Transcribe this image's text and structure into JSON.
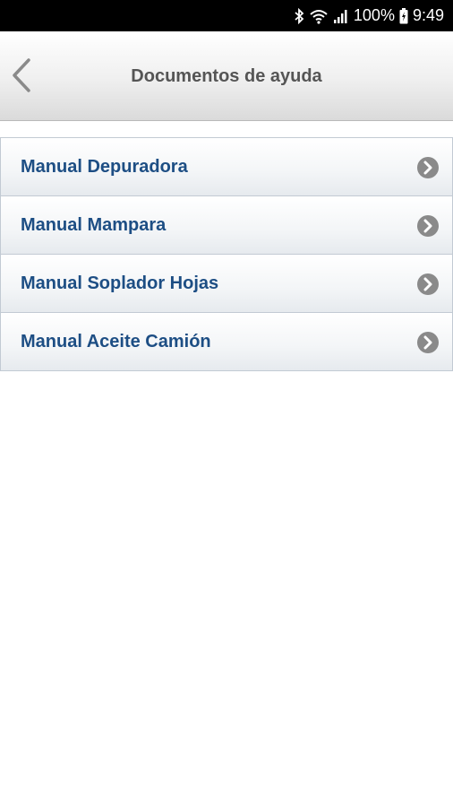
{
  "status_bar": {
    "battery": "100%",
    "time": "9:49",
    "icons": [
      "bluetooth-icon",
      "wifi-icon",
      "signal-icon",
      "battery-icon"
    ]
  },
  "header": {
    "title": "Documentos de ayuda",
    "back_icon": "chevron-left-icon"
  },
  "documents": [
    {
      "label": "Manual Depuradora"
    },
    {
      "label": "Manual Mampara"
    },
    {
      "label": "Manual Soplador Hojas"
    },
    {
      "label": "Manual Aceite Camión"
    }
  ],
  "colors": {
    "item_text": "#1d4e84",
    "title_text": "#555555",
    "chevron": "#8a8a8a"
  }
}
